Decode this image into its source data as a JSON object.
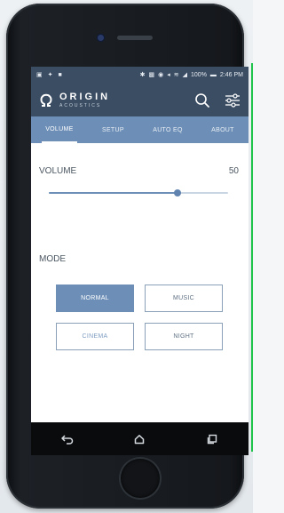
{
  "status_bar": {
    "battery": "100%",
    "time": "2:46 PM"
  },
  "header": {
    "brand_name": "ORIGIN",
    "brand_sub": "ACOUSTICS",
    "logo_icon": "omega-logo-icon",
    "search_icon": "search-icon",
    "settings_icon": "sliders-icon"
  },
  "tabs": [
    {
      "label": "VOLUME",
      "active": true
    },
    {
      "label": "SETUP",
      "active": false
    },
    {
      "label": "AUTO EQ",
      "active": false
    },
    {
      "label": "ABOUT",
      "active": false
    }
  ],
  "volume": {
    "label": "VOLUME",
    "value": "50",
    "level": 0.72
  },
  "mode": {
    "label": "MODE",
    "options": [
      {
        "label": "NORMAL",
        "selected": true
      },
      {
        "label": "MUSIC",
        "selected": false
      },
      {
        "label": "CINEMA",
        "selected": false
      },
      {
        "label": "NIGHT",
        "selected": false
      }
    ]
  },
  "nav": {
    "back_icon": "back-icon",
    "home_icon": "home-icon",
    "recents_icon": "recents-icon"
  },
  "colors": {
    "header_bg": "#3b4d63",
    "tab_bg": "#6d8fb7",
    "accent": "#6d8fb7"
  }
}
